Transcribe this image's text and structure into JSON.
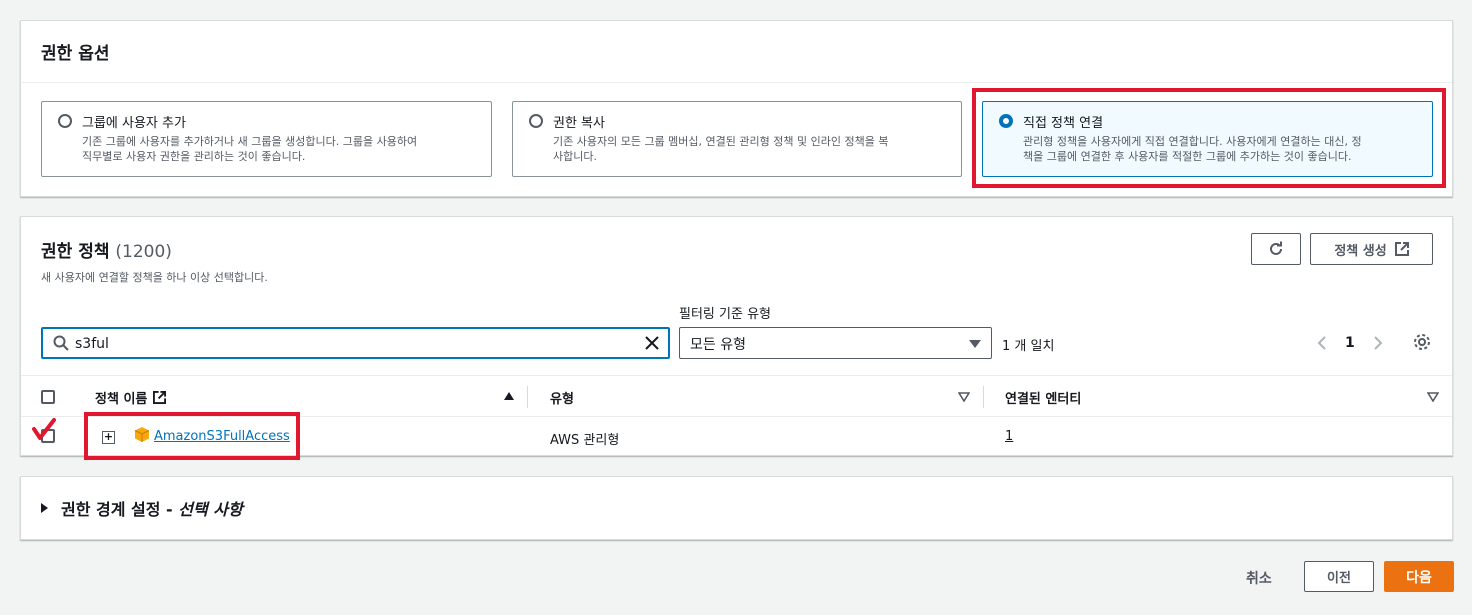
{
  "permission_options": {
    "title": "권한 옵션",
    "options": [
      {
        "label": "그룹에 사용자 추가",
        "desc1": "기존 그룹에 사용자를 추가하거나 새 그룹을 생성합니다. 그룹을 사용하여",
        "desc2": "직무별로 사용자 권한을 관리하는 것이 좋습니다.",
        "selected": false
      },
      {
        "label": "권한 복사",
        "desc1": "기존 사용자의 모든 그룹 멤버십, 연결된 관리형 정책 및 인라인 정책을 복",
        "desc2": "사합니다.",
        "selected": false
      },
      {
        "label": "직접 정책 연결",
        "desc1": "관리형 정책을 사용자에게 직접 연결합니다. 사용자에게 연결하는 대신, 정",
        "desc2": "책을 그룹에 연결한 후 사용자를 적절한 그룹에 추가하는 것이 좋습니다.",
        "selected": true
      }
    ]
  },
  "policies": {
    "title": "권한 정책",
    "count": "(1200)",
    "subtitle": "새 사용자에 연결할 정책을 하나 이상 선택합니다.",
    "create_button": "정책 생성",
    "filter_label": "필터링 기준 유형",
    "search_value": "s3ful",
    "filter_value": "모든 유형",
    "match_count": "1 개 일치",
    "page": "1",
    "columns": [
      "정책 이름",
      "유형",
      "연결된 엔터티"
    ],
    "rows": [
      {
        "name": "AmazonS3FullAccess",
        "type": "AWS 관리형",
        "entities": "1"
      }
    ]
  },
  "boundary": {
    "title": "권한 경계 설정 - ",
    "optional": "선택 사항"
  },
  "footer": {
    "cancel": "취소",
    "previous": "이전",
    "next": "다음"
  },
  "colors": {
    "accent": "#0073bb",
    "primary_button": "#ec7211",
    "highlight": "#e0172f"
  }
}
